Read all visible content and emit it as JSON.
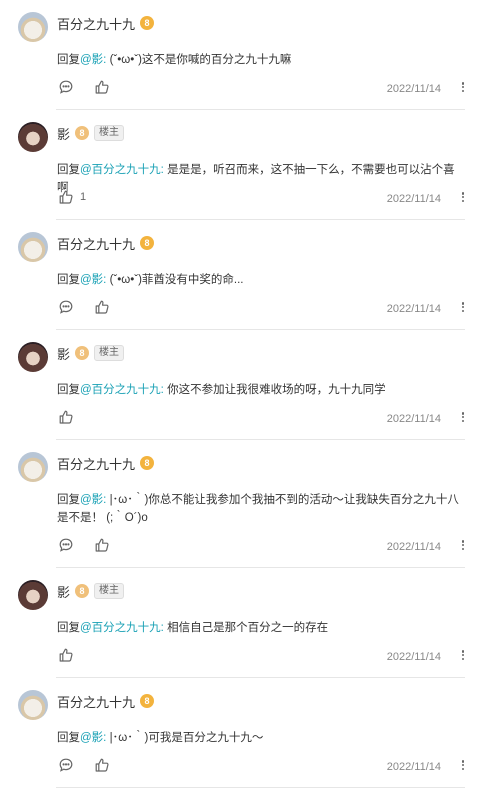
{
  "comments": [
    {
      "user": "百分之九十九",
      "avatar": "a",
      "level": "8",
      "op": false,
      "reply_prefix": "回复",
      "mention": "@影:",
      "text": " (ˇ•ω•ˇ)这不是你喊的百分之九十九嘛",
      "date": "2022/11/14",
      "show_reply_icon": true,
      "like_count": ""
    },
    {
      "user": "影",
      "avatar": "b",
      "level": "8",
      "op": true,
      "op_label": "楼主",
      "reply_prefix": "回复",
      "mention": "@百分之九十九:",
      "text": " 是是是，听召而来，这不抽一下么，不需要也可以沾个喜啊",
      "date": "2022/11/14",
      "show_reply_icon": false,
      "like_count": "1"
    },
    {
      "user": "百分之九十九",
      "avatar": "a",
      "level": "8",
      "op": false,
      "reply_prefix": "回复",
      "mention": "@影:",
      "text": " (ˇ•ω•ˇ)菲酋没有中奖的命...",
      "date": "2022/11/14",
      "show_reply_icon": true,
      "like_count": ""
    },
    {
      "user": "影",
      "avatar": "b",
      "level": "8",
      "op": true,
      "op_label": "楼主",
      "reply_prefix": "回复",
      "mention": "@百分之九十九:",
      "text": " 你这不参加让我很难收场的呀，九十九同学",
      "date": "2022/11/14",
      "show_reply_icon": false,
      "like_count": ""
    },
    {
      "user": "百分之九十九",
      "avatar": "a",
      "level": "8",
      "op": false,
      "reply_prefix": "回复",
      "mention": "@影:",
      "text": " |･ω･｀)你总不能让我参加个我抽不到的活动～让我缺失百分之九十八是不是！ (;｀O´)o",
      "date": "2022/11/14",
      "show_reply_icon": true,
      "like_count": "",
      "tall": true
    },
    {
      "user": "影",
      "avatar": "b",
      "level": "8",
      "op": true,
      "op_label": "楼主",
      "reply_prefix": "回复",
      "mention": "@百分之九十九:",
      "text": " 相信自己是那个百分之一的存在",
      "date": "2022/11/14",
      "show_reply_icon": false,
      "like_count": ""
    },
    {
      "user": "百分之九十九",
      "avatar": "a",
      "level": "8",
      "op": false,
      "reply_prefix": "回复",
      "mention": "@影:",
      "text": " |･ω･｀)可我是百分之九十九～",
      "date": "2022/11/14",
      "show_reply_icon": true,
      "like_count": ""
    }
  ],
  "icons": {
    "reply": "comment-bubble-icon",
    "like": "thumbs-up-icon",
    "more": "vertical-ellipsis-icon"
  },
  "colors": {
    "mention": "#1aa1b5",
    "level_badge": "#f3b33d"
  }
}
